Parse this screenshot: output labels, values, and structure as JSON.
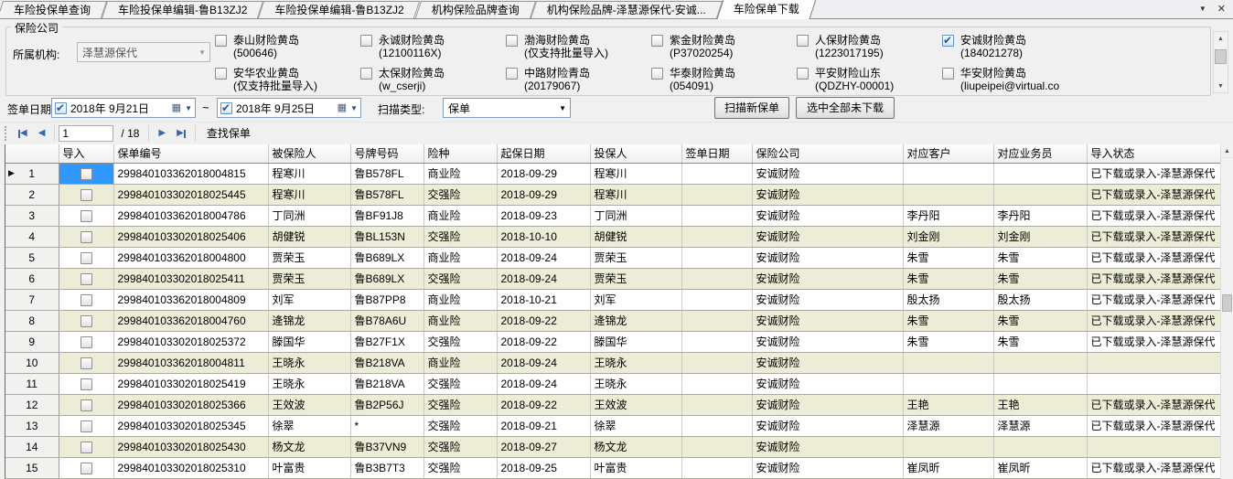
{
  "colors": {
    "selection_blue": "#2F98FF",
    "alt_row_beige": "#ECECD7",
    "check_blue": "#1F57AE"
  },
  "icons": {
    "dropdown": "▼",
    "close": "✕",
    "combo_arrow": "▼",
    "calendar": "▦",
    "scroll_up": "▲",
    "scroll_down": "▼",
    "prev_page": "◀",
    "next_page": "▶",
    "row_pointer": "▶",
    "tilde": "~"
  },
  "tabs": {
    "active_index": 5,
    "items": [
      {
        "label": "车险投保单查询"
      },
      {
        "label": "车险投保单编辑-鲁B13ZJ2"
      },
      {
        "label": "车险投保单编辑-鲁B13ZJ2"
      },
      {
        "label": "机构保险品牌查询"
      },
      {
        "label": "机构保险品牌-泽慧源保代-安诚..."
      },
      {
        "label": "车险保单下载"
      }
    ]
  },
  "filter": {
    "groupbox_label": "保险公司",
    "org_label": "所属机构:",
    "org_value": "泽慧源保代",
    "companies": [
      {
        "name": "泰山财险黄岛",
        "id": "(500646)",
        "checked": false
      },
      {
        "name": "永诚财险黄岛",
        "id": "(12100116X)",
        "checked": false
      },
      {
        "name": "渤海财险黄岛",
        "id": "(仅支持批量导入)",
        "checked": false
      },
      {
        "name": "紫金财险黄岛",
        "id": "(P37020254)",
        "checked": false
      },
      {
        "name": "人保财险黄岛",
        "id": "(1223017195)",
        "checked": false
      },
      {
        "name": "安诚财险黄岛",
        "id": "(184021278)",
        "checked": true
      },
      {
        "name": "安华农业黄岛",
        "id": "(仅支持批量导入)",
        "checked": false
      },
      {
        "name": "太保财险黄岛",
        "id": "(w_cserji)",
        "checked": false
      },
      {
        "name": "中路财险青岛",
        "id": "(20179067)",
        "checked": false
      },
      {
        "name": "华泰财险黄岛",
        "id": "(054091)",
        "checked": false
      },
      {
        "name": "平安财险山东",
        "id": "(QDZHY-00001)",
        "checked": false
      },
      {
        "name": "华安财险黄岛",
        "id": "(liupeipei@virtual.co",
        "checked": false
      }
    ],
    "date_label": "签单日期",
    "date_from": "2018年  9月21日",
    "date_from_checked": true,
    "date_to": "2018年  9月25日",
    "date_to_checked": true,
    "range_separator": "~",
    "scan_type_label": "扫描类型:",
    "scan_type_value": "保单",
    "scan_button": "扫描新保单",
    "select_all_button": "选中全部未下载"
  },
  "pager": {
    "page_value": "1",
    "page_total": "/ 18",
    "find_button": "查找保单"
  },
  "grid": {
    "selected_row_index": 0,
    "columns": [
      "",
      "导入",
      "保单编号",
      "被保险人",
      "号牌号码",
      "险种",
      "起保日期",
      "投保人",
      "签单日期",
      "保险公司",
      "对应客户",
      "对应业务员",
      "导入状态"
    ],
    "rows": [
      {
        "num": "1",
        "policy": "299840103362018004815",
        "insured": "程寒川",
        "plate": "鲁B578FL",
        "type": "商业险",
        "start_date": "2018-09-29",
        "applicant": "程寒川",
        "sign_date": "",
        "company": "安诚财险",
        "customer": "",
        "agent": "",
        "status": "已下载或录入-泽慧源保代"
      },
      {
        "num": "2",
        "policy": "299840103302018025445",
        "insured": "程寒川",
        "plate": "鲁B578FL",
        "type": "交强险",
        "start_date": "2018-09-29",
        "applicant": "程寒川",
        "sign_date": "",
        "company": "安诚财险",
        "customer": "",
        "agent": "",
        "status": "已下载或录入-泽慧源保代"
      },
      {
        "num": "3",
        "policy": "299840103362018004786",
        "insured": "丁同洲",
        "plate": "鲁BF91J8",
        "type": "商业险",
        "start_date": "2018-09-23",
        "applicant": "丁同洲",
        "sign_date": "",
        "company": "安诚财险",
        "customer": "李丹阳",
        "agent": "李丹阳",
        "status": "已下载或录入-泽慧源保代"
      },
      {
        "num": "4",
        "policy": "299840103302018025406",
        "insured": "胡健锐",
        "plate": "鲁BL153N",
        "type": "交强险",
        "start_date": "2018-10-10",
        "applicant": "胡健锐",
        "sign_date": "",
        "company": "安诚财险",
        "customer": "刘金刚",
        "agent": "刘金刚",
        "status": "已下载或录入-泽慧源保代"
      },
      {
        "num": "5",
        "policy": "299840103362018004800",
        "insured": "贾荣玉",
        "plate": "鲁B689LX",
        "type": "商业险",
        "start_date": "2018-09-24",
        "applicant": "贾荣玉",
        "sign_date": "",
        "company": "安诚财险",
        "customer": "朱雪",
        "agent": "朱雪",
        "status": "已下载或录入-泽慧源保代"
      },
      {
        "num": "6",
        "policy": "299840103302018025411",
        "insured": "贾荣玉",
        "plate": "鲁B689LX",
        "type": "交强险",
        "start_date": "2018-09-24",
        "applicant": "贾荣玉",
        "sign_date": "",
        "company": "安诚财险",
        "customer": "朱雪",
        "agent": "朱雪",
        "status": "已下载或录入-泽慧源保代"
      },
      {
        "num": "7",
        "policy": "299840103362018004809",
        "insured": "刘军",
        "plate": "鲁B87PP8",
        "type": "商业险",
        "start_date": "2018-10-21",
        "applicant": "刘军",
        "sign_date": "",
        "company": "安诚财险",
        "customer": "殷太扬",
        "agent": "殷太扬",
        "status": "已下载或录入-泽慧源保代"
      },
      {
        "num": "8",
        "policy": "299840103362018004760",
        "insured": "逄锦龙",
        "plate": "鲁B78A6U",
        "type": "商业险",
        "start_date": "2018-09-22",
        "applicant": "逄锦龙",
        "sign_date": "",
        "company": "安诚财险",
        "customer": "朱雪",
        "agent": "朱雪",
        "status": "已下载或录入-泽慧源保代"
      },
      {
        "num": "9",
        "policy": "299840103302018025372",
        "insured": "滕国华",
        "plate": "鲁B27F1X",
        "type": "交强险",
        "start_date": "2018-09-22",
        "applicant": "滕国华",
        "sign_date": "",
        "company": "安诚财险",
        "customer": "朱雪",
        "agent": "朱雪",
        "status": "已下载或录入-泽慧源保代"
      },
      {
        "num": "10",
        "policy": "299840103362018004811",
        "insured": "王晓永",
        "plate": "鲁B218VA",
        "type": "商业险",
        "start_date": "2018-09-24",
        "applicant": "王晓永",
        "sign_date": "",
        "company": "安诚财险",
        "customer": "",
        "agent": "",
        "status": ""
      },
      {
        "num": "11",
        "policy": "299840103302018025419",
        "insured": "王晓永",
        "plate": "鲁B218VA",
        "type": "交强险",
        "start_date": "2018-09-24",
        "applicant": "王晓永",
        "sign_date": "",
        "company": "安诚财险",
        "customer": "",
        "agent": "",
        "status": ""
      },
      {
        "num": "12",
        "policy": "299840103302018025366",
        "insured": "王效波",
        "plate": "鲁B2P56J",
        "type": "交强险",
        "start_date": "2018-09-22",
        "applicant": "王效波",
        "sign_date": "",
        "company": "安诚财险",
        "customer": "王艳",
        "agent": "王艳",
        "status": "已下载或录入-泽慧源保代"
      },
      {
        "num": "13",
        "policy": "299840103302018025345",
        "insured": "徐翠",
        "plate": "*",
        "type": "交强险",
        "start_date": "2018-09-21",
        "applicant": "徐翠",
        "sign_date": "",
        "company": "安诚财险",
        "customer": "泽慧源",
        "agent": "泽慧源",
        "status": "已下载或录入-泽慧源保代"
      },
      {
        "num": "14",
        "policy": "299840103302018025430",
        "insured": "杨文龙",
        "plate": "鲁B37VN9",
        "type": "交强险",
        "start_date": "2018-09-27",
        "applicant": "杨文龙",
        "sign_date": "",
        "company": "安诚财险",
        "customer": "",
        "agent": "",
        "status": ""
      },
      {
        "num": "15",
        "policy": "299840103302018025310",
        "insured": "叶富贵",
        "plate": "鲁B3B7T3",
        "type": "交强险",
        "start_date": "2018-09-25",
        "applicant": "叶富贵",
        "sign_date": "",
        "company": "安诚财险",
        "customer": "崔凤昕",
        "agent": "崔凤昕",
        "status": "已下载或录入-泽慧源保代"
      }
    ]
  }
}
